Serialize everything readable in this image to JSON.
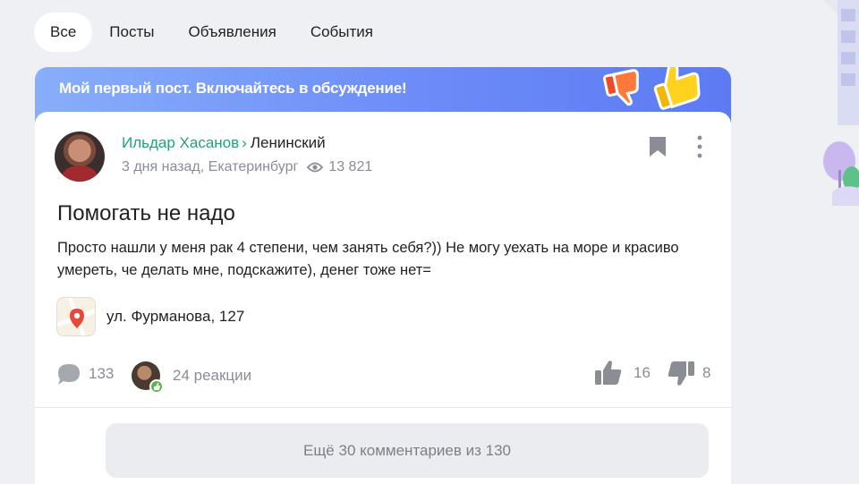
{
  "tabs": [
    {
      "label": "Все",
      "active": true
    },
    {
      "label": "Посты",
      "active": false
    },
    {
      "label": "Объявления",
      "active": false
    },
    {
      "label": "События",
      "active": false
    }
  ],
  "banner": {
    "text": "Мой первый пост. Включайтесь в обсуждение!"
  },
  "post": {
    "author": "Ильдар Хасанов",
    "separator": "›",
    "district": "Ленинский",
    "time_location": "3 дня назад, Екатеринбург",
    "views": "13 821",
    "title": "Помогать не надо",
    "text": "Просто нашли у меня рак 4 степени, чем занять себя?)) Не могу уехать на море и красиво умереть, че делать мне, подскажите), денег тоже нет=",
    "address": "ул. Фурманова, 127",
    "comments_count": "133",
    "reactions": "24 реакции",
    "likes": "16",
    "dislikes": "8",
    "more_comments": "Ещё 30 комментариев из 130"
  },
  "colors": {
    "accent_green": "#2a9d78",
    "banner_blue": "#6d8cf8",
    "muted": "#8a8d94"
  },
  "icons": [
    "eye-icon",
    "bookmark-icon",
    "more-vertical-icon",
    "map-pin-icon",
    "comment-icon",
    "thumb-up-icon",
    "thumb-down-icon"
  ]
}
